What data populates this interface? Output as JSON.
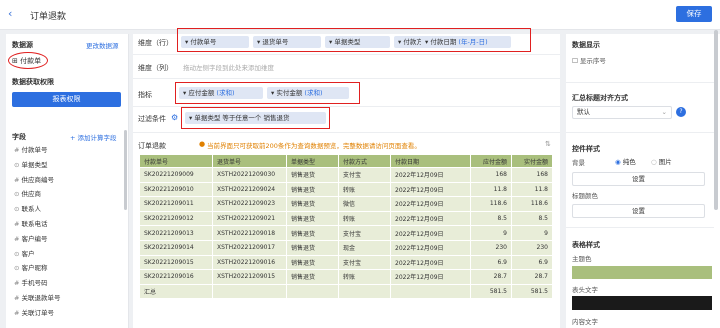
{
  "header": {
    "title": "订单退款",
    "save": "保存"
  },
  "left": {
    "ds_title": "数据源",
    "ds_change": "更改数据源",
    "ds_item": "付款单",
    "perm_title": "数据获取权限",
    "perm_btn": "报表权限",
    "fields_title": "字段",
    "add_calc": "添加计算字段",
    "fields": [
      "付款单号",
      "单据类型",
      "供应商编号",
      "供应商",
      "联系人",
      "联系电话",
      "客户编号",
      "客户",
      "客户昵称",
      "手机号码",
      "关联退款单号",
      "关联订单号"
    ]
  },
  "config": {
    "dim_label": "维度（行）",
    "dims": [
      "付款单号",
      "退货单号",
      "单据类型",
      "付款方式",
      "付款日期"
    ],
    "date_suffix": "(年-月-日)",
    "col_label": "维度（列）",
    "col_placeholder": "拖动左侧字段到此处来添加维度",
    "metric_label": "指标",
    "metrics": [
      "应付金额",
      "实付金额"
    ],
    "metric_suffix": "(求和)",
    "filter_label": "过滤条件",
    "filter": "单据类型 等于任意一个 销售退货"
  },
  "report": {
    "title": "订单退款",
    "note": "当前界面只可获取前200条作为查询数据预览，完整数据请访问页面查看。",
    "columns": [
      "付款单号",
      "退货单号",
      "单据类型",
      "付款方式",
      "付款日期",
      "应付金额",
      "实付金额"
    ],
    "rows": [
      [
        "SK20221209009",
        "XSTH20221209030",
        "销售退货",
        "支付宝",
        "2022年12月09日",
        "168",
        "168"
      ],
      [
        "SK20221209010",
        "XSTH20221209024",
        "销售退货",
        "转账",
        "2022年12月09日",
        "11.8",
        "11.8"
      ],
      [
        "SK20221209011",
        "XSTH20221209023",
        "销售退货",
        "微信",
        "2022年12月09日",
        "118.6",
        "118.6"
      ],
      [
        "SK20221209012",
        "XSTH20221209021",
        "销售退货",
        "转账",
        "2022年12月09日",
        "8.5",
        "8.5"
      ],
      [
        "SK20221209013",
        "XSTH20221209018",
        "销售退货",
        "支付宝",
        "2022年12月09日",
        "9",
        "9"
      ],
      [
        "SK20221209014",
        "XSTH20221209017",
        "销售退货",
        "现金",
        "2022年12月09日",
        "230",
        "230"
      ],
      [
        "SK20221209015",
        "XSTH20221209016",
        "销售退货",
        "支付宝",
        "2022年12月09日",
        "6.9",
        "6.9"
      ],
      [
        "SK20221209016",
        "XSTH20221209015",
        "销售退货",
        "转账",
        "2022年12月09日",
        "28.7",
        "28.7"
      ]
    ],
    "total_label": "汇总",
    "total_pay": "581.5",
    "total_paid": "581.5"
  },
  "right": {
    "display_title": "数据显示",
    "show_index": "显示序号",
    "align_title": "汇总标题对齐方式",
    "align_value": "默认",
    "ctrl_title": "控件样式",
    "bg_label": "背景",
    "opt_color": "纯色",
    "opt_image": "图片",
    "set_btn": "设置",
    "title_color": "标题颜色",
    "set_btn2": "设置",
    "table_title": "表格样式",
    "theme_color": "主题色",
    "header_text": "表头文字",
    "content_text": "内容文字",
    "colors": {
      "theme": "#a9bf7d",
      "header": "#1a1a1a",
      "accent": "#2d6fe0",
      "mark": "#e02020"
    }
  }
}
